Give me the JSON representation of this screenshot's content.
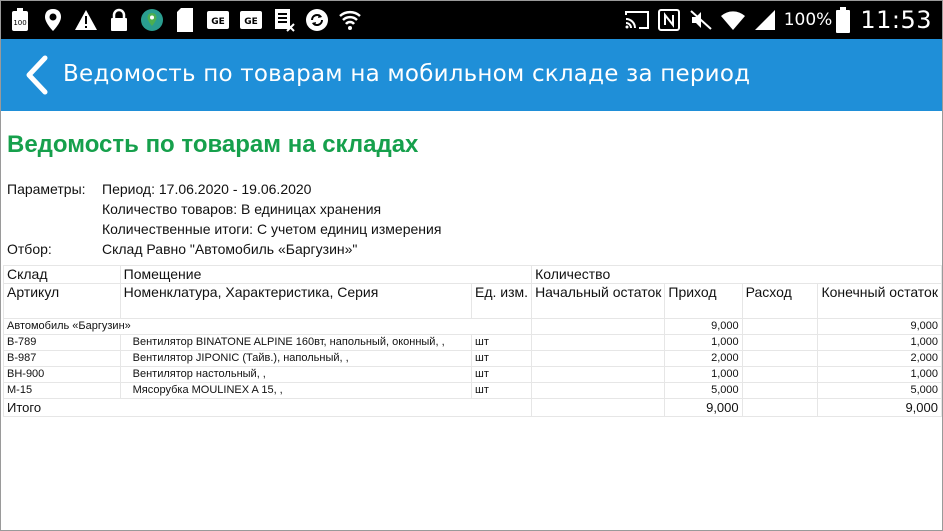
{
  "status_bar": {
    "left_icons": [
      "battery-100-icon",
      "location-pin-icon",
      "warning-icon",
      "lock-icon",
      "maps-icon",
      "sim-card-icon",
      "ge-icon",
      "ge-icon",
      "excel-icon",
      "sync-icon",
      "wifi-shield-icon"
    ],
    "battery_percent": "100%",
    "time": "11:53"
  },
  "header": {
    "title": "Ведомость по товарам на мобильном складе за период",
    "color": "#1f8fd8"
  },
  "report": {
    "heading": "Ведомость по товарам на складах",
    "heading_color": "#16a04c",
    "params": {
      "label": "Параметры:",
      "period": "Период: 17.06.2020 - 19.06.2020",
      "qty_mode": "Количество товаров: В единицах хранения",
      "totals": "Количественные итоги: С учетом единиц измерения"
    },
    "filter": {
      "label": "Отбор:",
      "value": "Склад Равно \"Автомобиль «Баргузин»\""
    }
  },
  "table": {
    "header1": {
      "warehouse": "Склад",
      "room": "Помещение",
      "quantity": "Количество"
    },
    "header2": {
      "article": "Артикул",
      "nomenclature": "Номенклатура, Характеристика, Серия",
      "unit": "Ед. изм.",
      "opening": "Начальный остаток",
      "income": "Приход",
      "expense": "Расход",
      "closing": "Конечный остаток"
    },
    "group": {
      "name": "Автомобиль «Баргузин»",
      "income": "9,000",
      "closing": "9,000"
    },
    "rows": [
      {
        "article": "B-789",
        "name": "Вентилятор BINATONE ALPINE 160вт, напольный, оконный, ,",
        "unit": "шт",
        "income": "1,000",
        "closing": "1,000"
      },
      {
        "article": "B-987",
        "name": "Вентилятор JIPONIC (Тайв.), напольный, ,",
        "unit": "шт",
        "income": "2,000",
        "closing": "2,000"
      },
      {
        "article": "BH-900",
        "name": "Вентилятор настольный, ,",
        "unit": "шт",
        "income": "1,000",
        "closing": "1,000"
      },
      {
        "article": "M-15",
        "name": "Мясорубка MOULINEX A 15, ,",
        "unit": "шт",
        "income": "5,000",
        "closing": "5,000"
      }
    ],
    "total": {
      "label": "Итого",
      "income": "9,000",
      "closing": "9,000"
    }
  }
}
